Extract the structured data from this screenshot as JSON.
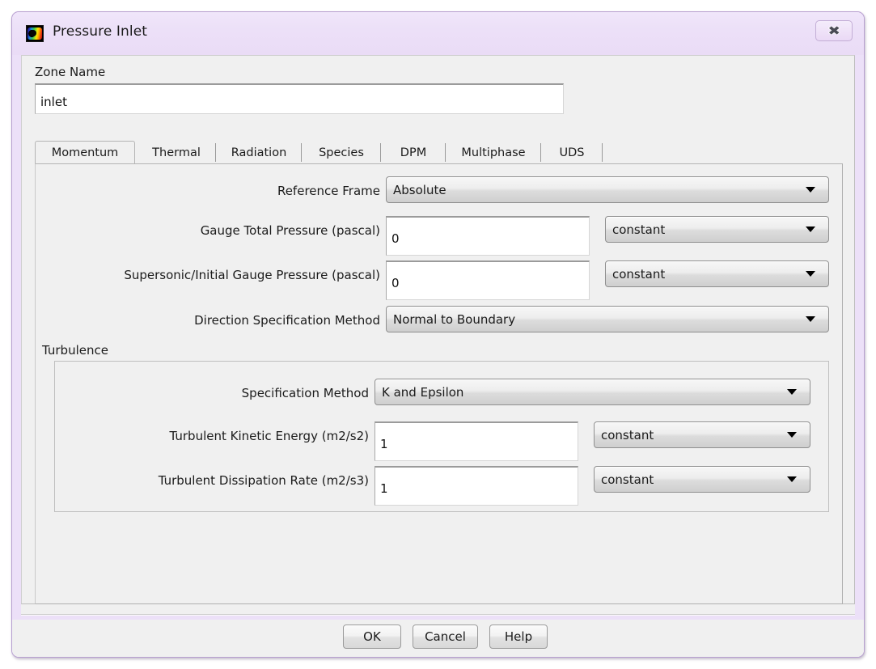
{
  "window": {
    "title": "Pressure Inlet",
    "icon": "fluent-app-icon",
    "close_label": "✖",
    "close_glyph": "✖"
  },
  "zone": {
    "label": "Zone Name",
    "value": "inlet",
    "placeholder": ""
  },
  "tabs": [
    {
      "label": "Momentum",
      "active": true
    },
    {
      "label": "Thermal",
      "active": false
    },
    {
      "label": "Radiation",
      "active": false
    },
    {
      "label": "Species",
      "active": false
    },
    {
      "label": "DPM",
      "active": false
    },
    {
      "label": "Multiphase",
      "active": false
    },
    {
      "label": "UDS",
      "active": false
    }
  ],
  "momentum": {
    "reference_frame": {
      "label": "Reference Frame",
      "value": "Absolute"
    },
    "gauge_total_pressure": {
      "label": "Gauge Total Pressure (pascal)",
      "value": "0",
      "method": "constant"
    },
    "supersonic_initial_gauge_pressure": {
      "label": "Supersonic/Initial Gauge Pressure (pascal)",
      "value": "0",
      "method": "constant"
    },
    "direction_specification_method": {
      "label": "Direction Specification Method",
      "value": "Normal to Boundary"
    }
  },
  "turbulence": {
    "group_title": "Turbulence",
    "specification_method": {
      "label": "Specification Method",
      "value": "K and Epsilon"
    },
    "turbulent_kinetic_energy": {
      "label": "Turbulent Kinetic Energy (m2/s2)",
      "value": "1",
      "method": "constant"
    },
    "turbulent_dissipation_rate": {
      "label": "Turbulent Dissipation Rate (m2/s3)",
      "value": "1",
      "method": "constant"
    }
  },
  "buttons": {
    "ok": "OK",
    "cancel": "Cancel",
    "help": "Help"
  },
  "colors": {
    "titlebar": "#ece0f8",
    "window_border": "#b79fd0",
    "client_bg": "#f0f0f0",
    "field_bg": "#ffffff",
    "text": "#1b1b1b"
  }
}
